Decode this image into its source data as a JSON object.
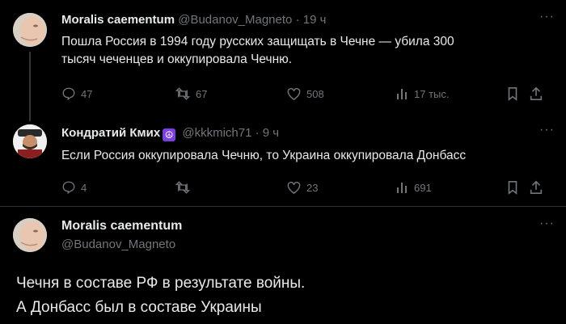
{
  "tweet1": {
    "name": "Moralis caementum",
    "handle": "@Budanov_Magneto",
    "sep": "·",
    "time": "19 ч",
    "text_line1": "Пошла Россия в 1994 году русских защищать в Чечне — убила 300",
    "text_line2": "тысяч чеченцев и оккупировала Чечню.",
    "replies": "47",
    "reposts": "67",
    "likes": "508",
    "views": "17 тыс."
  },
  "tweet2": {
    "name": "Кондратий Кмих",
    "badge": "☮",
    "handle": "@kkkmich71",
    "sep": "·",
    "time": "9 ч",
    "text": "Если Россия оккупировала Чечню, то Украина оккупировала Донбасс",
    "replies": "4",
    "reposts": "",
    "likes": "23",
    "views": "691"
  },
  "main_tweet": {
    "name": "Moralis caementum",
    "handle": "@Budanov_Magneto",
    "text_line1": "Чечня в составе РФ в результате войны.",
    "text_line2": "А Донбасс был в составе Украины"
  },
  "more_label": "···",
  "colors": {
    "background": "#000000",
    "text": "#e7e9ea",
    "secondary": "#71767b",
    "divider": "#2f3336",
    "badge": "#7b3fe4"
  }
}
